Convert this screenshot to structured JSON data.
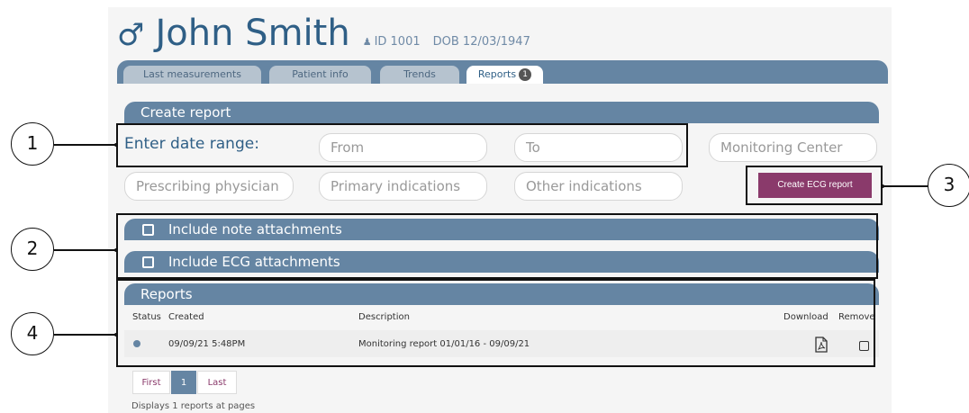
{
  "patient": {
    "gender_symbol": "♂",
    "name": "John Smith",
    "id_icon": "person-icon",
    "id_text": "ID 1001",
    "dob_text": "DOB 12/03/1947"
  },
  "tabs": [
    {
      "label": "Last measurements"
    },
    {
      "label": "Patient info"
    },
    {
      "label": "Trends"
    },
    {
      "label": "Reports",
      "badge": "1"
    }
  ],
  "create_report": {
    "title": "Create report",
    "date_range_label": "Enter date range:",
    "from_placeholder": "From",
    "to_placeholder": "To",
    "monitoring_center_placeholder": "Monitoring Center",
    "prescribing_physician_placeholder": "Prescribing physician",
    "primary_indications_placeholder": "Primary indications",
    "other_indications_placeholder": "Other indications",
    "create_button": "Create ECG report"
  },
  "options": {
    "include_notes": "Include note attachments",
    "include_ecg": "Include ECG attachments"
  },
  "reports": {
    "title": "Reports",
    "columns": {
      "status": "Status",
      "created": "Created",
      "description": "Description",
      "download": "Download",
      "remove": "Remove"
    },
    "rows": [
      {
        "created": "09/09/21 5:48PM",
        "description": "Monitoring report 01/01/16 - 09/09/21"
      }
    ]
  },
  "pagination": {
    "first": "First",
    "page": "1",
    "last": "Last",
    "summary": "Displays 1 reports at pages"
  },
  "callouts": [
    "1",
    "2",
    "3",
    "4"
  ],
  "colors": {
    "accent": "#6585a3",
    "title": "#2f5f86",
    "button": "#8a3a6b"
  }
}
